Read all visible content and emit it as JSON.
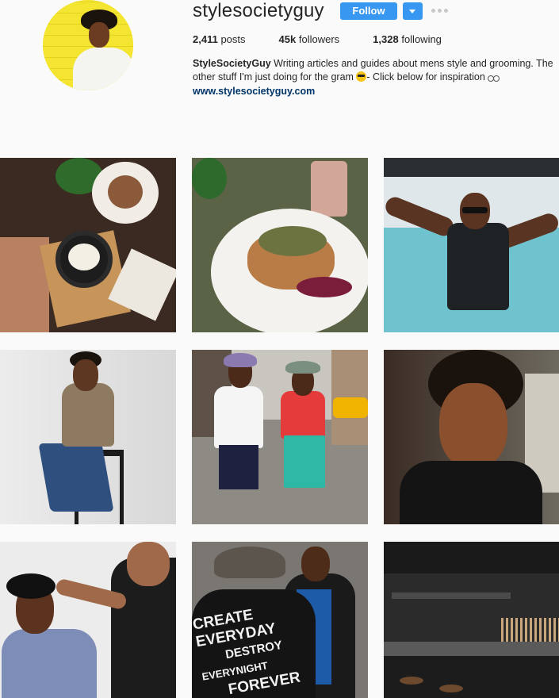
{
  "profile": {
    "username": "stylesocietyguy",
    "follow_label": "Follow",
    "stats": {
      "posts_count": "2,411",
      "posts_label": "posts",
      "followers_count": "45k",
      "followers_label": "followers",
      "following_count": "1,328",
      "following_label": "following"
    },
    "bio": {
      "name": "StyleSocietyGuy",
      "text": " Writing articles and guides about mens style and grooming. The other stuff I'm just doing for the gram ",
      "text_after_emoji": "- Click below for inspiration ",
      "link": "www.stylesocietyguy.com"
    },
    "emojis": [
      "sunglasses-face-emoji",
      "glasses-emoji"
    ],
    "accent_color": "#3897f0",
    "link_color": "#003569"
  },
  "posts": [
    {
      "subject": "food-flatlay"
    },
    {
      "subject": "pancake-plate"
    },
    {
      "subject": "sailing-man"
    },
    {
      "subject": "man-on-stool"
    },
    {
      "subject": "street-couple"
    },
    {
      "subject": "portrait"
    },
    {
      "subject": "barber"
    },
    {
      "subject": "leather-jacket"
    },
    {
      "subject": "kitchen"
    }
  ],
  "post_writing": {
    "line1": "CREATE",
    "line2": "EVERYDAY",
    "line3": "DESTROY",
    "line4": "EVERYNIGHT",
    "line5": "FOREVER"
  }
}
